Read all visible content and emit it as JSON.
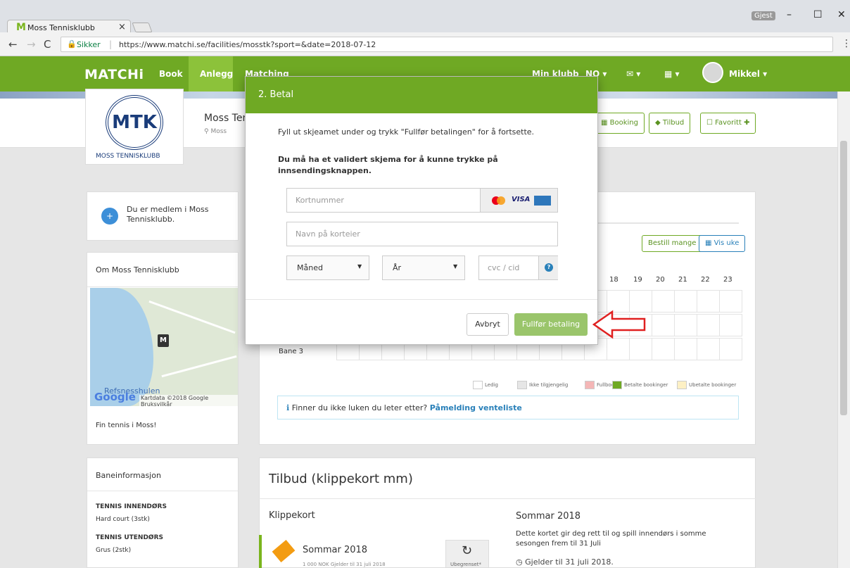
{
  "browser": {
    "tab_title": "Moss Tennisklubb",
    "tab_favicon": "M",
    "guest_label": "Gjest",
    "secure_label": "Sikker",
    "url": "https://www.matchi.se/facilities/mosstk?sport=&date=2018-07-12"
  },
  "navbar": {
    "brand": "MATCHi",
    "links": [
      "Book",
      "Anlegg",
      "Matching"
    ],
    "right_links": [
      "Min klubb",
      "NO",
      "",
      ""
    ],
    "user": "Mikkel"
  },
  "club": {
    "logo_letters": "MTK",
    "logo_caption": "MOSS TENNISKLUBB",
    "name": "Moss Tennisklubb",
    "location": "Moss",
    "buttons": [
      "Booking",
      "Tilbud",
      "Favoritt"
    ]
  },
  "sidebar": {
    "member_text": "Du er medlem i Moss Tennisklubb.",
    "about_title": "Om Moss Tennisklubb",
    "map_place": "Refsnesshulen",
    "map_google": "Google",
    "map_credit": "Kartdata ©2018 Google   Bruksvilkår",
    "about_text": "Fin tennis i Moss!",
    "courts_title": "Baneinformasjon",
    "courts": [
      {
        "title": "TENNIS INNENDØRS",
        "desc": "Hard court (3stk)"
      },
      {
        "title": "TENNIS UTENDØRS",
        "desc": "Grus (2stk)"
      }
    ]
  },
  "booking": {
    "btn_many": "Bestill mange",
    "btn_week": "Vis uke",
    "hours": [
      "18",
      "19",
      "20",
      "21",
      "22",
      "23"
    ],
    "court_label": "Bane 3",
    "legend": [
      {
        "label": "Ledig",
        "color": "#ffffff"
      },
      {
        "label": "Ikke tilgjengelig",
        "color": "#e6e6e6"
      },
      {
        "label": "Fullbooket",
        "color": "#f4b6b6"
      },
      {
        "label": "Betalte bookinger",
        "color": "#6fa924"
      },
      {
        "label": "Ubetalte bookinger",
        "color": "#fdf0c4"
      }
    ],
    "info_text": "Finner du ikke luken du leter etter?",
    "info_link": "Påmelding venteliste"
  },
  "offers": {
    "title": "Tilbud (klippekort mm)",
    "section": "Klippekort",
    "card_name": "Sommar 2018",
    "card_sub": "1 000 NOK  Gjelder til 31 juli 2018",
    "unlimited_label": "Ubegrenset*",
    "detail_title": "Sommar 2018",
    "detail_desc": "Dette kortet gir deg rett til og spill innendørs i somme sesongen frem til 31 Juli",
    "detail_valid": "Gjelder til 31 juli 2018."
  },
  "modal": {
    "title": "2. Betal",
    "intro": "Fyll ut skjeamet under og trykk \"Fullfør betalingen\" for å fortsette.",
    "warning": "Du må ha et validert skjema for å kunne trykke på innsendingsknappen.",
    "card_placeholder": "Kortnummer",
    "name_placeholder": "Navn på korteier",
    "month_label": "Måned",
    "year_label": "År",
    "cvc_placeholder": "cvc / cid",
    "cancel_label": "Avbryt",
    "pay_label": "Fullfør betaling",
    "visa_label": "VISA"
  },
  "colors": {
    "brand_green": "#6fa924",
    "pay_button": "#9ac56b",
    "arrow_red": "#e02020"
  }
}
